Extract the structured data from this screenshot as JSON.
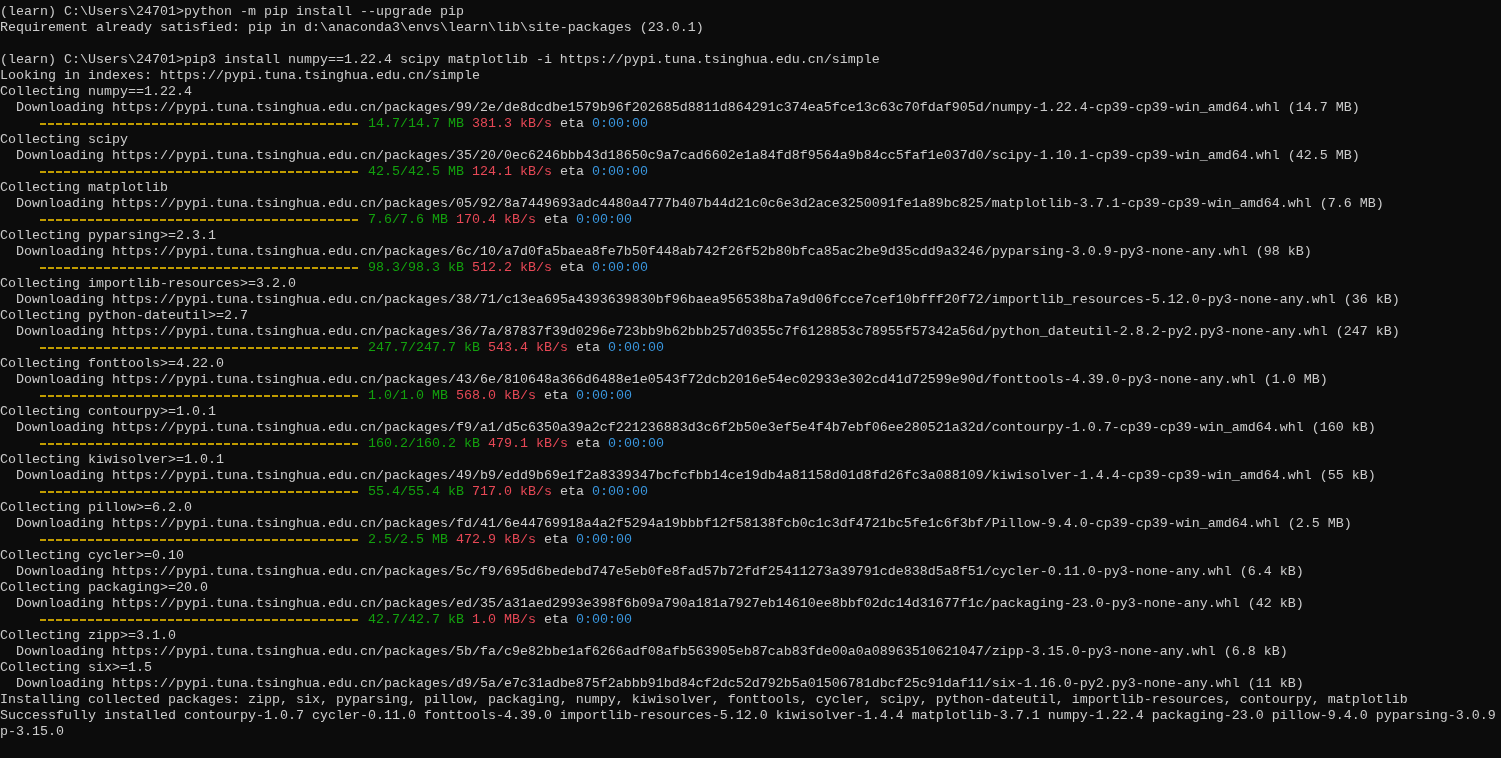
{
  "terminal": {
    "lines": [
      {
        "kind": "plain",
        "text": "(learn) C:\\Users\\24701>python -m pip install --upgrade pip"
      },
      {
        "kind": "plain",
        "text": "Requirement already satisfied: pip in d:\\anaconda3\\envs\\learn\\lib\\site-packages (23.0.1)"
      },
      {
        "kind": "blank"
      },
      {
        "kind": "plain",
        "text": "(learn) C:\\Users\\24701>pip3 install numpy==1.22.4 scipy matplotlib -i https://pypi.tuna.tsinghua.edu.cn/simple"
      },
      {
        "kind": "plain",
        "text": "Looking in indexes: https://pypi.tuna.tsinghua.edu.cn/simple"
      },
      {
        "kind": "plain",
        "text": "Collecting numpy==1.22.4"
      },
      {
        "kind": "indented",
        "text": "Downloading https://pypi.tuna.tsinghua.edu.cn/packages/99/2e/de8dcdbe1579b96f202685d8811d864291c374ea5fce13c63c70fdaf905d/numpy-1.22.4-cp39-cp39-win_amd64.whl (14.7 MB)"
      },
      {
        "kind": "progress",
        "level": 1,
        "size": "14.7/14.7 MB",
        "speed": "381.3 kB/s",
        "eta_label": "eta",
        "eta": "0:00:00"
      },
      {
        "kind": "plain",
        "text": "Collecting scipy"
      },
      {
        "kind": "indented",
        "text": "Downloading https://pypi.tuna.tsinghua.edu.cn/packages/35/20/0ec6246bbb43d18650c9a7cad6602e1a84fd8f9564a9b84cc5faf1e037d0/scipy-1.10.1-cp39-cp39-win_amd64.whl (42.5 MB)"
      },
      {
        "kind": "progress",
        "level": 1,
        "size": "42.5/42.5 MB",
        "speed": "124.1 kB/s",
        "eta_label": "eta",
        "eta": "0:00:00"
      },
      {
        "kind": "plain",
        "text": "Collecting matplotlib"
      },
      {
        "kind": "indented",
        "text": "Downloading https://pypi.tuna.tsinghua.edu.cn/packages/05/92/8a7449693adc4480a4777b407b44d21c0c6e3d2ace3250091fe1a89bc825/matplotlib-3.7.1-cp39-cp39-win_amd64.whl (7.6 MB)"
      },
      {
        "kind": "progress",
        "level": 1,
        "size": "7.6/7.6 MB",
        "speed": "170.4 kB/s",
        "eta_label": "eta",
        "eta": "0:00:00"
      },
      {
        "kind": "plain",
        "text": "Collecting pyparsing>=2.3.1"
      },
      {
        "kind": "indented",
        "text": "Downloading https://pypi.tuna.tsinghua.edu.cn/packages/6c/10/a7d0fa5baea8fe7b50f448ab742f26f52b80bfca85ac2be9d35cdd9a3246/pyparsing-3.0.9-py3-none-any.whl (98 kB)"
      },
      {
        "kind": "progress",
        "level": 1,
        "size": "98.3/98.3 kB",
        "speed": "512.2 kB/s",
        "eta_label": "eta",
        "eta": "0:00:00"
      },
      {
        "kind": "plain",
        "text": "Collecting importlib-resources>=3.2.0"
      },
      {
        "kind": "indented",
        "text": "Downloading https://pypi.tuna.tsinghua.edu.cn/packages/38/71/c13ea695a4393639830bf96baea956538ba7a9d06fcce7cef10bfff20f72/importlib_resources-5.12.0-py3-none-any.whl (36 kB)"
      },
      {
        "kind": "plain",
        "text": "Collecting python-dateutil>=2.7"
      },
      {
        "kind": "indented",
        "text": "Downloading https://pypi.tuna.tsinghua.edu.cn/packages/36/7a/87837f39d0296e723bb9b62bbb257d0355c7f6128853c78955f57342a56d/python_dateutil-2.8.2-py2.py3-none-any.whl (247 kB)"
      },
      {
        "kind": "progress",
        "level": 1,
        "size": "247.7/247.7 kB",
        "speed": "543.4 kB/s",
        "eta_label": "eta",
        "eta": "0:00:00"
      },
      {
        "kind": "plain",
        "text": "Collecting fonttools>=4.22.0"
      },
      {
        "kind": "indented",
        "text": "Downloading https://pypi.tuna.tsinghua.edu.cn/packages/43/6e/810648a366d6488e1e0543f72dcb2016e54ec02933e302cd41d72599e90d/fonttools-4.39.0-py3-none-any.whl (1.0 MB)"
      },
      {
        "kind": "progress",
        "level": 1,
        "size": "1.0/1.0 MB",
        "speed": "568.0 kB/s",
        "eta_label": "eta",
        "eta": "0:00:00"
      },
      {
        "kind": "plain",
        "text": "Collecting contourpy>=1.0.1"
      },
      {
        "kind": "indented",
        "text": "Downloading https://pypi.tuna.tsinghua.edu.cn/packages/f9/a1/d5c6350a39a2cf221236883d3c6f2b50e3ef5e4f4b7ebf06ee280521a32d/contourpy-1.0.7-cp39-cp39-win_amd64.whl (160 kB)"
      },
      {
        "kind": "progress",
        "level": 1,
        "size": "160.2/160.2 kB",
        "speed": "479.1 kB/s",
        "eta_label": "eta",
        "eta": "0:00:00"
      },
      {
        "kind": "plain",
        "text": "Collecting kiwisolver>=1.0.1"
      },
      {
        "kind": "indented",
        "text": "Downloading https://pypi.tuna.tsinghua.edu.cn/packages/49/b9/edd9b69e1f2a8339347bcfcfbb14ce19db4a81158d01d8fd26fc3a088109/kiwisolver-1.4.4-cp39-cp39-win_amd64.whl (55 kB)"
      },
      {
        "kind": "progress",
        "level": 1,
        "size": "55.4/55.4 kB",
        "speed": "717.0 kB/s",
        "eta_label": "eta",
        "eta": "0:00:00"
      },
      {
        "kind": "plain",
        "text": "Collecting pillow>=6.2.0"
      },
      {
        "kind": "indented",
        "text": "Downloading https://pypi.tuna.tsinghua.edu.cn/packages/fd/41/6e44769918a4a2f5294a19bbbf12f58138fcb0c1c3df4721bc5fe1c6f3bf/Pillow-9.4.0-cp39-cp39-win_amd64.whl (2.5 MB)"
      },
      {
        "kind": "progress",
        "level": 1,
        "size": "2.5/2.5 MB",
        "speed": "472.9 kB/s",
        "eta_label": "eta",
        "eta": "0:00:00"
      },
      {
        "kind": "plain",
        "text": "Collecting cycler>=0.10"
      },
      {
        "kind": "indented",
        "text": "Downloading https://pypi.tuna.tsinghua.edu.cn/packages/5c/f9/695d6bedebd747e5eb0fe8fad57b72fdf25411273a39791cde838d5a8f51/cycler-0.11.0-py3-none-any.whl (6.4 kB)"
      },
      {
        "kind": "plain",
        "text": "Collecting packaging>=20.0"
      },
      {
        "kind": "indented",
        "text": "Downloading https://pypi.tuna.tsinghua.edu.cn/packages/ed/35/a31aed2993e398f6b09a790a181a7927eb14610ee8bbf02dc14d31677f1c/packaging-23.0-py3-none-any.whl (42 kB)"
      },
      {
        "kind": "progress",
        "level": 1,
        "size": "42.7/42.7 kB",
        "speed": "1.0 MB/s",
        "eta_label": "eta",
        "eta": "0:00:00"
      },
      {
        "kind": "plain",
        "text": "Collecting zipp>=3.1.0"
      },
      {
        "kind": "indented",
        "text": "Downloading https://pypi.tuna.tsinghua.edu.cn/packages/5b/fa/c9e82bbe1af6266adf08afb563905eb87cab83fde00a0a08963510621047/zipp-3.15.0-py3-none-any.whl (6.8 kB)"
      },
      {
        "kind": "plain",
        "text": "Collecting six>=1.5"
      },
      {
        "kind": "indented",
        "text": "Downloading https://pypi.tuna.tsinghua.edu.cn/packages/d9/5a/e7c31adbe875f2abbb91bd84cf2dc52d792b5a01506781dbcf25c91daf11/six-1.16.0-py2.py3-none-any.whl (11 kB)"
      },
      {
        "kind": "plain",
        "text": "Installing collected packages: zipp, six, pyparsing, pillow, packaging, numpy, kiwisolver, fonttools, cycler, scipy, python-dateutil, importlib-resources, contourpy, matplotlib"
      },
      {
        "kind": "plain",
        "text": "Successfully installed contourpy-1.0.7 cycler-0.11.0 fonttools-4.39.0 importlib-resources-5.12.0 kiwisolver-1.4.4 matplotlib-3.7.1 numpy-1.22.4 packaging-23.0 pillow-9.4.0 pyparsing-3.0.9"
      },
      {
        "kind": "plain",
        "text": "p-3.15.0"
      }
    ]
  }
}
